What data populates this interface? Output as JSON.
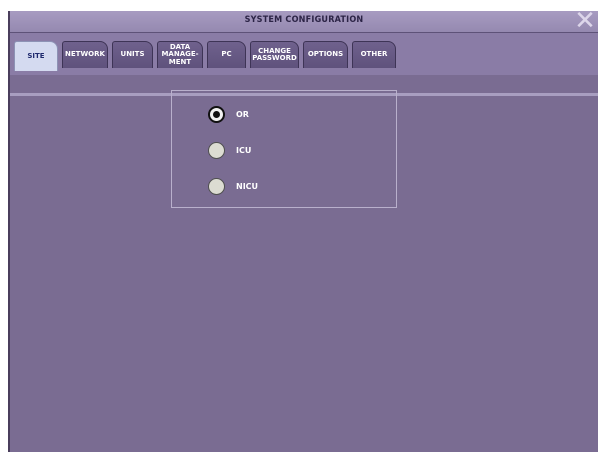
{
  "window": {
    "title": "SYSTEM CONFIGURATION",
    "close_glyph": "✕"
  },
  "tabs": [
    {
      "label": "SITE",
      "active": true
    },
    {
      "label": "NETWORK",
      "active": false
    },
    {
      "label": "UNITS",
      "active": false
    },
    {
      "label": "DATA\nMANAGE-\nMENT",
      "active": false
    },
    {
      "label": "PC",
      "active": false
    },
    {
      "label": "CHANGE\nPASSWORD",
      "active": false
    },
    {
      "label": "OPTIONS",
      "active": false
    },
    {
      "label": "OTHER",
      "active": false
    }
  ],
  "site": {
    "options": [
      {
        "label": "OR",
        "selected": true
      },
      {
        "label": "ICU",
        "selected": false
      },
      {
        "label": "NICU",
        "selected": false
      }
    ]
  },
  "colors": {
    "background": "#7a6c92",
    "titlebar": "#9589b0",
    "tab": "#5f527c",
    "active_tab": "#d4daf0",
    "active_tab_text": "#1f2a6e"
  }
}
